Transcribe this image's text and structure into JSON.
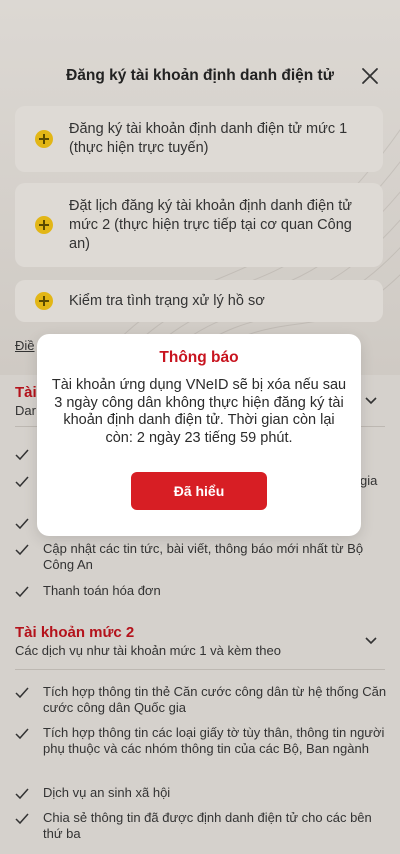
{
  "header": {
    "title": "Đăng ký tài khoản định danh điện tử"
  },
  "options": [
    {
      "label": "Đăng ký tài khoản định danh điện tử mức 1 (thực hiện trực tuyến)"
    },
    {
      "label": "Đặt lịch đăng ký tài khoản định danh điện tử mức 2 (thực hiện trực tiếp tại cơ quan Công an)"
    },
    {
      "label": "Kiểm tra tình trạng xử lý hồ sơ"
    }
  ],
  "partial_link": "Điề",
  "tier1": {
    "title_partial": "Tài",
    "sub_partial": "Dar",
    "partial_tail": "gia",
    "features": [
      "Cập nhật các tin tức, bài viết, thông báo mới nhất từ Bộ Công An",
      "Thanh toán hóa đơn"
    ]
  },
  "tier2": {
    "title": "Tài khoản mức 2",
    "subtitle": "Các dịch vụ như tài khoản mức 1 và kèm theo",
    "features": [
      "Tích hợp thông tin thẻ Căn cước công dân từ hệ thống Căn cước công dân Quốc gia",
      "Tích hợp thông tin các loại giấy tờ tùy thân, thông tin người phụ thuộc và các nhóm thông tin của các Bộ, Ban ngành",
      "Dịch vụ an sinh xã hội",
      "Chia sẻ thông tin đã được định danh điện tử cho các bên thứ ba"
    ]
  },
  "modal": {
    "title": "Thông báo",
    "message": "Tài khoản ứng dụng VNeID sẽ bị xóa nếu sau 3 ngày công dân không thực hiện đăng ký tài khoản định danh điện tử. Thời gian còn lại còn: 2 ngày 23 tiếng 59 phút.",
    "confirm_label": "Đã hiểu"
  },
  "colors": {
    "accent": "#d71e24",
    "title_red": "#b4121b",
    "plus_yellow": "#e2b616"
  }
}
